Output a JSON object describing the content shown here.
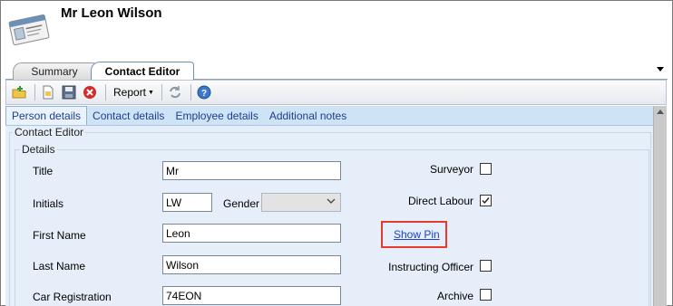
{
  "header": {
    "title": "Mr Leon Wilson",
    "icon": "contact-card-icon"
  },
  "tabs": [
    {
      "label": "Summary",
      "active": false
    },
    {
      "label": "Contact Editor",
      "active": true
    }
  ],
  "toolbar": {
    "report_label": "Report",
    "icons": [
      "new-folder-icon",
      "new-document-icon",
      "save-icon",
      "close-icon",
      "refresh-icon",
      "help-icon"
    ]
  },
  "subtabs": [
    {
      "label": "Person details",
      "active": true
    },
    {
      "label": "Contact details",
      "active": false
    },
    {
      "label": "Employee details",
      "active": false
    },
    {
      "label": "Additional notes",
      "active": false
    }
  ],
  "form": {
    "group_title": "Contact Editor",
    "subgroup_title": "Details",
    "title": {
      "label": "Title",
      "value": "Mr"
    },
    "initials": {
      "label": "Initials",
      "value": "LW"
    },
    "gender": {
      "label": "Gender",
      "value": ""
    },
    "first_name": {
      "label": "First Name",
      "value": "Leon"
    },
    "last_name": {
      "label": "Last Name",
      "value": "Wilson"
    },
    "car_registration": {
      "label": "Car Registration",
      "value": "74EON"
    },
    "surveyor": {
      "label": "Surveyor",
      "checked": false
    },
    "direct_labour": {
      "label": "Direct Labour",
      "checked": true
    },
    "show_pin": {
      "label": "Show Pin"
    },
    "instructing_officer": {
      "label": "Instructing Officer",
      "checked": false
    },
    "archive": {
      "label": "Archive",
      "checked": false
    }
  },
  "colors": {
    "highlight_border": "#e8392f",
    "link": "#1f3fcc",
    "subtab_bar": "#cfe3f7",
    "content_bg": "#e5eef9"
  }
}
